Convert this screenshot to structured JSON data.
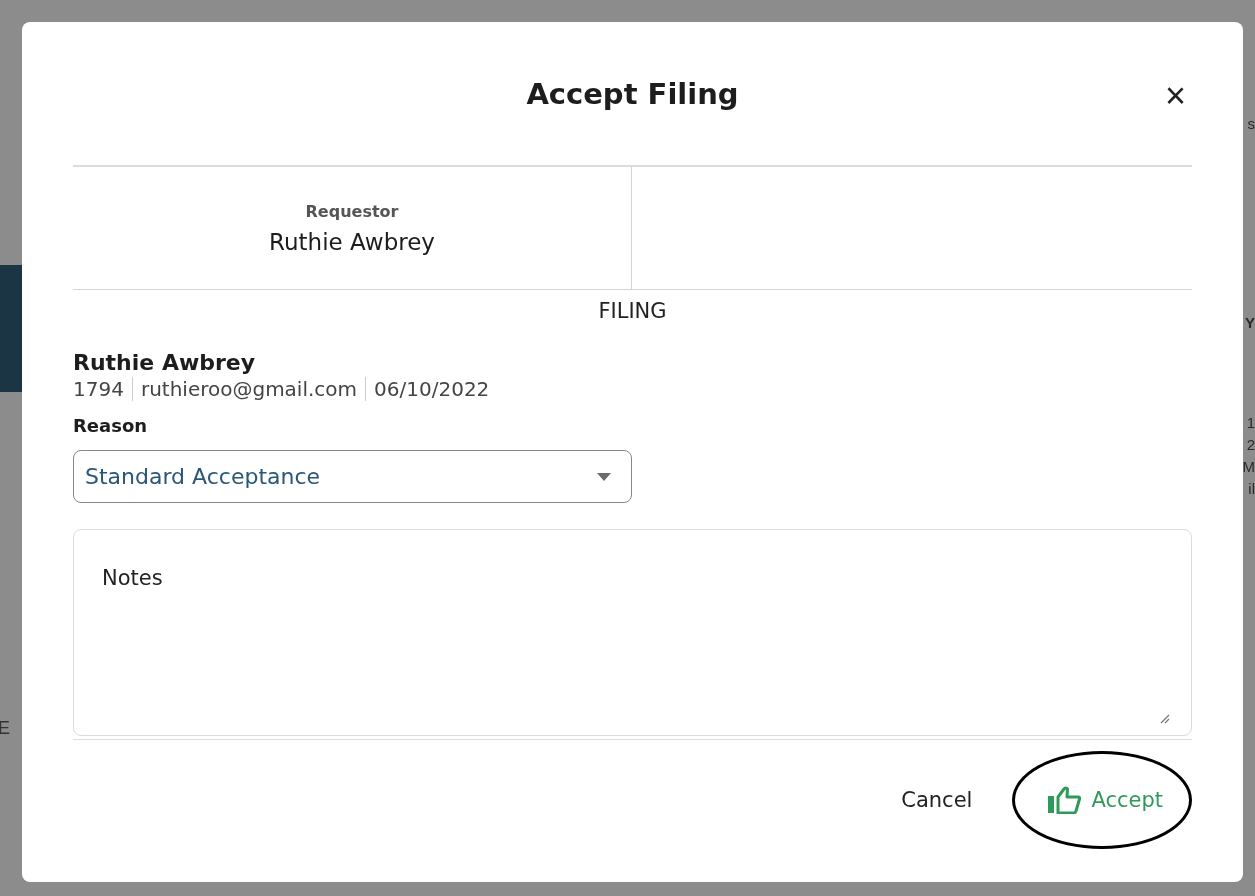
{
  "background": {
    "left_fragments": [
      "E"
    ],
    "right_fragments": [
      "s",
      "Y",
      "1",
      "2",
      "M",
      "il"
    ]
  },
  "dialog": {
    "title": "Accept Filing",
    "close": "×",
    "requestor": {
      "label": "Requestor",
      "name": "Ruthie Awbrey"
    },
    "section": "FILING",
    "filer": {
      "name": "Ruthie Awbrey",
      "details": [
        "1794",
        "ruthieroo@gmail.com",
        "06/10/2022"
      ]
    },
    "reason": {
      "label": "Reason",
      "value": "Standard Acceptance"
    },
    "notes": {
      "placeholder": "Notes"
    },
    "buttons": [
      {
        "label": "Cancel",
        "kind": "text",
        "highlighted": false
      },
      {
        "label": "Accept",
        "kind": "accept",
        "highlighted": true
      }
    ]
  }
}
